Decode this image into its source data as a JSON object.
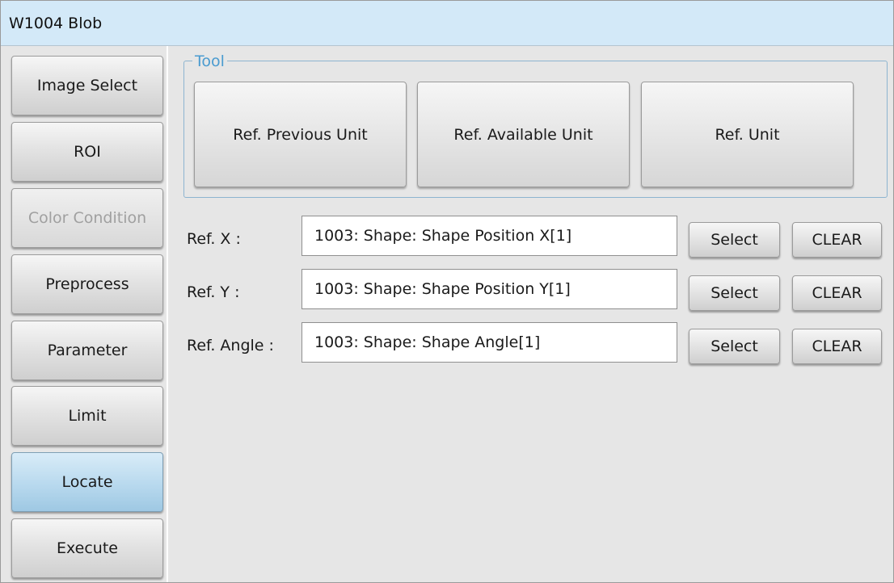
{
  "window": {
    "title": "W1004 Blob"
  },
  "sidebar": {
    "items": [
      {
        "label": "Image Select",
        "state": "normal"
      },
      {
        "label": "ROI",
        "state": "normal"
      },
      {
        "label": "Color Condition",
        "state": "disabled"
      },
      {
        "label": "Preprocess",
        "state": "normal"
      },
      {
        "label": "Parameter",
        "state": "normal"
      },
      {
        "label": "Limit",
        "state": "normal"
      },
      {
        "label": "Locate",
        "state": "active"
      },
      {
        "label": "Execute",
        "state": "normal"
      }
    ]
  },
  "tool": {
    "legend": "Tool",
    "buttons": [
      {
        "label": "Ref. Previous Unit"
      },
      {
        "label": "Ref. Available Unit"
      },
      {
        "label": "Ref. Unit"
      }
    ]
  },
  "refs": [
    {
      "label": "Ref. X :",
      "value": "1003: Shape: Shape Position X[1]",
      "select_label": "Select",
      "clear_label": "CLEAR"
    },
    {
      "label": "Ref. Y :",
      "value": "1003: Shape: Shape Position Y[1]",
      "select_label": "Select",
      "clear_label": "CLEAR"
    },
    {
      "label": "Ref. Angle :",
      "value": "1003: Shape: Shape Angle[1]",
      "select_label": "Select",
      "clear_label": "CLEAR"
    }
  ],
  "colors": {
    "title_bar": "#d3e9f8",
    "active_item": "#b8d9ee",
    "legend_text": "#4a9bd0",
    "background": "#e6e6e6",
    "disabled_text": "#a0a0a0"
  }
}
